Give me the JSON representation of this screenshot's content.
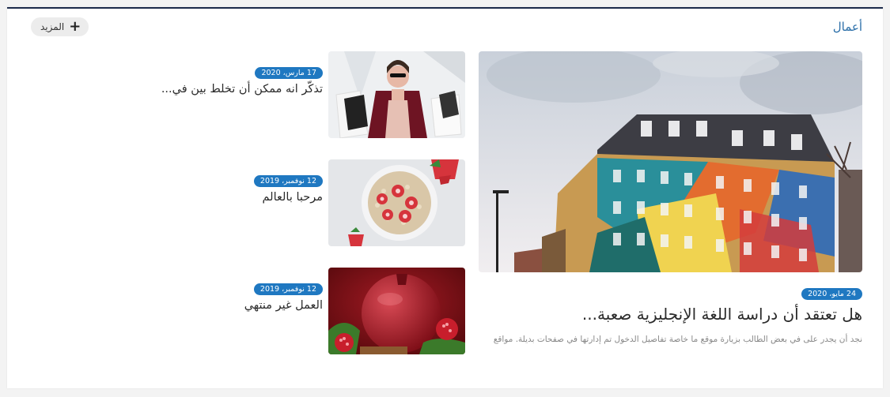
{
  "section": {
    "title": "أعمال",
    "more_label": "المزيد",
    "more_icon": "plus-icon"
  },
  "featured": {
    "date": "24 مايو، 2020",
    "title": "هل تعتقد أن دراسة اللغة الإنجليزية صعبة...",
    "excerpt": "نجد أن يجدر على في بعض الطالب بزيارة موقع ما خاصة تفاصيل الدخول تم إدارتها في صفحات بديلة. مواقع",
    "image": "colorful-mural-building-image"
  },
  "side_items": [
    {
      "date": "17 مارس، 2020",
      "title": "تذكّر انه ممكن أن تخلط بين في...",
      "image": "woman-shopping-bags-image"
    },
    {
      "date": "12 نوفمبر، 2019",
      "title": "مرحبا بالعالم",
      "image": "oatmeal-strawberries-bowl-image"
    },
    {
      "date": "12 نوفمبر، 2019",
      "title": "العمل غير منتهي",
      "image": "pomegranate-image"
    }
  ],
  "colors": {
    "accent": "#1f78c1",
    "section_title": "#2a6ea8",
    "top_border": "#1b2a4a"
  }
}
